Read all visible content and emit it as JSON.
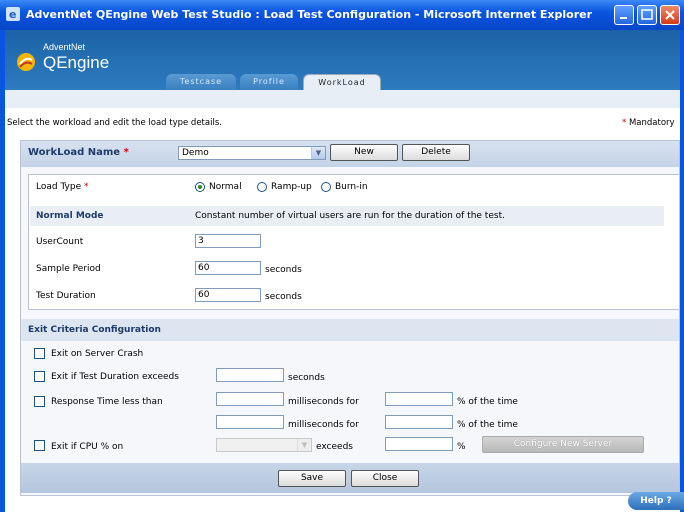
{
  "window": {
    "title": "AdventNet QEngine Web Test Studio : Load Test Configuration - Microsoft Internet Explorer"
  },
  "logo": {
    "small": "AdventNet",
    "big": "QEngine"
  },
  "tabs": [
    {
      "label": "Testcase"
    },
    {
      "label": "Profile"
    },
    {
      "label": "WorkLoad"
    }
  ],
  "instruction": "Select the workload and edit the load type details.",
  "mandatory_label": "Mandatory",
  "workload": {
    "label": "WorkLoad Name",
    "selected": "Demo",
    "new_label": "New",
    "delete_label": "Delete"
  },
  "load_type": {
    "label": "Load Type",
    "options": [
      {
        "label": "Normal",
        "checked": true
      },
      {
        "label": "Ramp-up",
        "checked": false
      },
      {
        "label": "Burn-in",
        "checked": false
      }
    ],
    "mode_title": "Normal Mode",
    "mode_desc": "Constant number of virtual users are run for the duration of the test."
  },
  "fields": {
    "user_count": {
      "label": "UserCount",
      "value": "3"
    },
    "sample_period": {
      "label": "Sample Period",
      "value": "60",
      "unit": "seconds"
    },
    "test_duration": {
      "label": "Test Duration",
      "value": "60",
      "unit": "seconds"
    }
  },
  "exit": {
    "title": "Exit Criteria Configuration",
    "server_crash": "Exit on Server Crash",
    "duration_exceeds": "Exit if Test Duration exceeds",
    "seconds": "seconds",
    "response_time": "Response Time less than",
    "ms_for": "milliseconds for",
    "pct_time": "% of the time",
    "cpu": "Exit if CPU % on",
    "exceeds": "exceeds",
    "pct": "%",
    "configure_btn": "Configure New Server"
  },
  "buttons": {
    "save": "Save",
    "close": "Close"
  },
  "help": "Help ?",
  "colors": {
    "title_bar": "#0a55e0",
    "header": "#2370b5",
    "mandatory_star": "#dd0000",
    "label_blue": "#1f3b6b"
  }
}
